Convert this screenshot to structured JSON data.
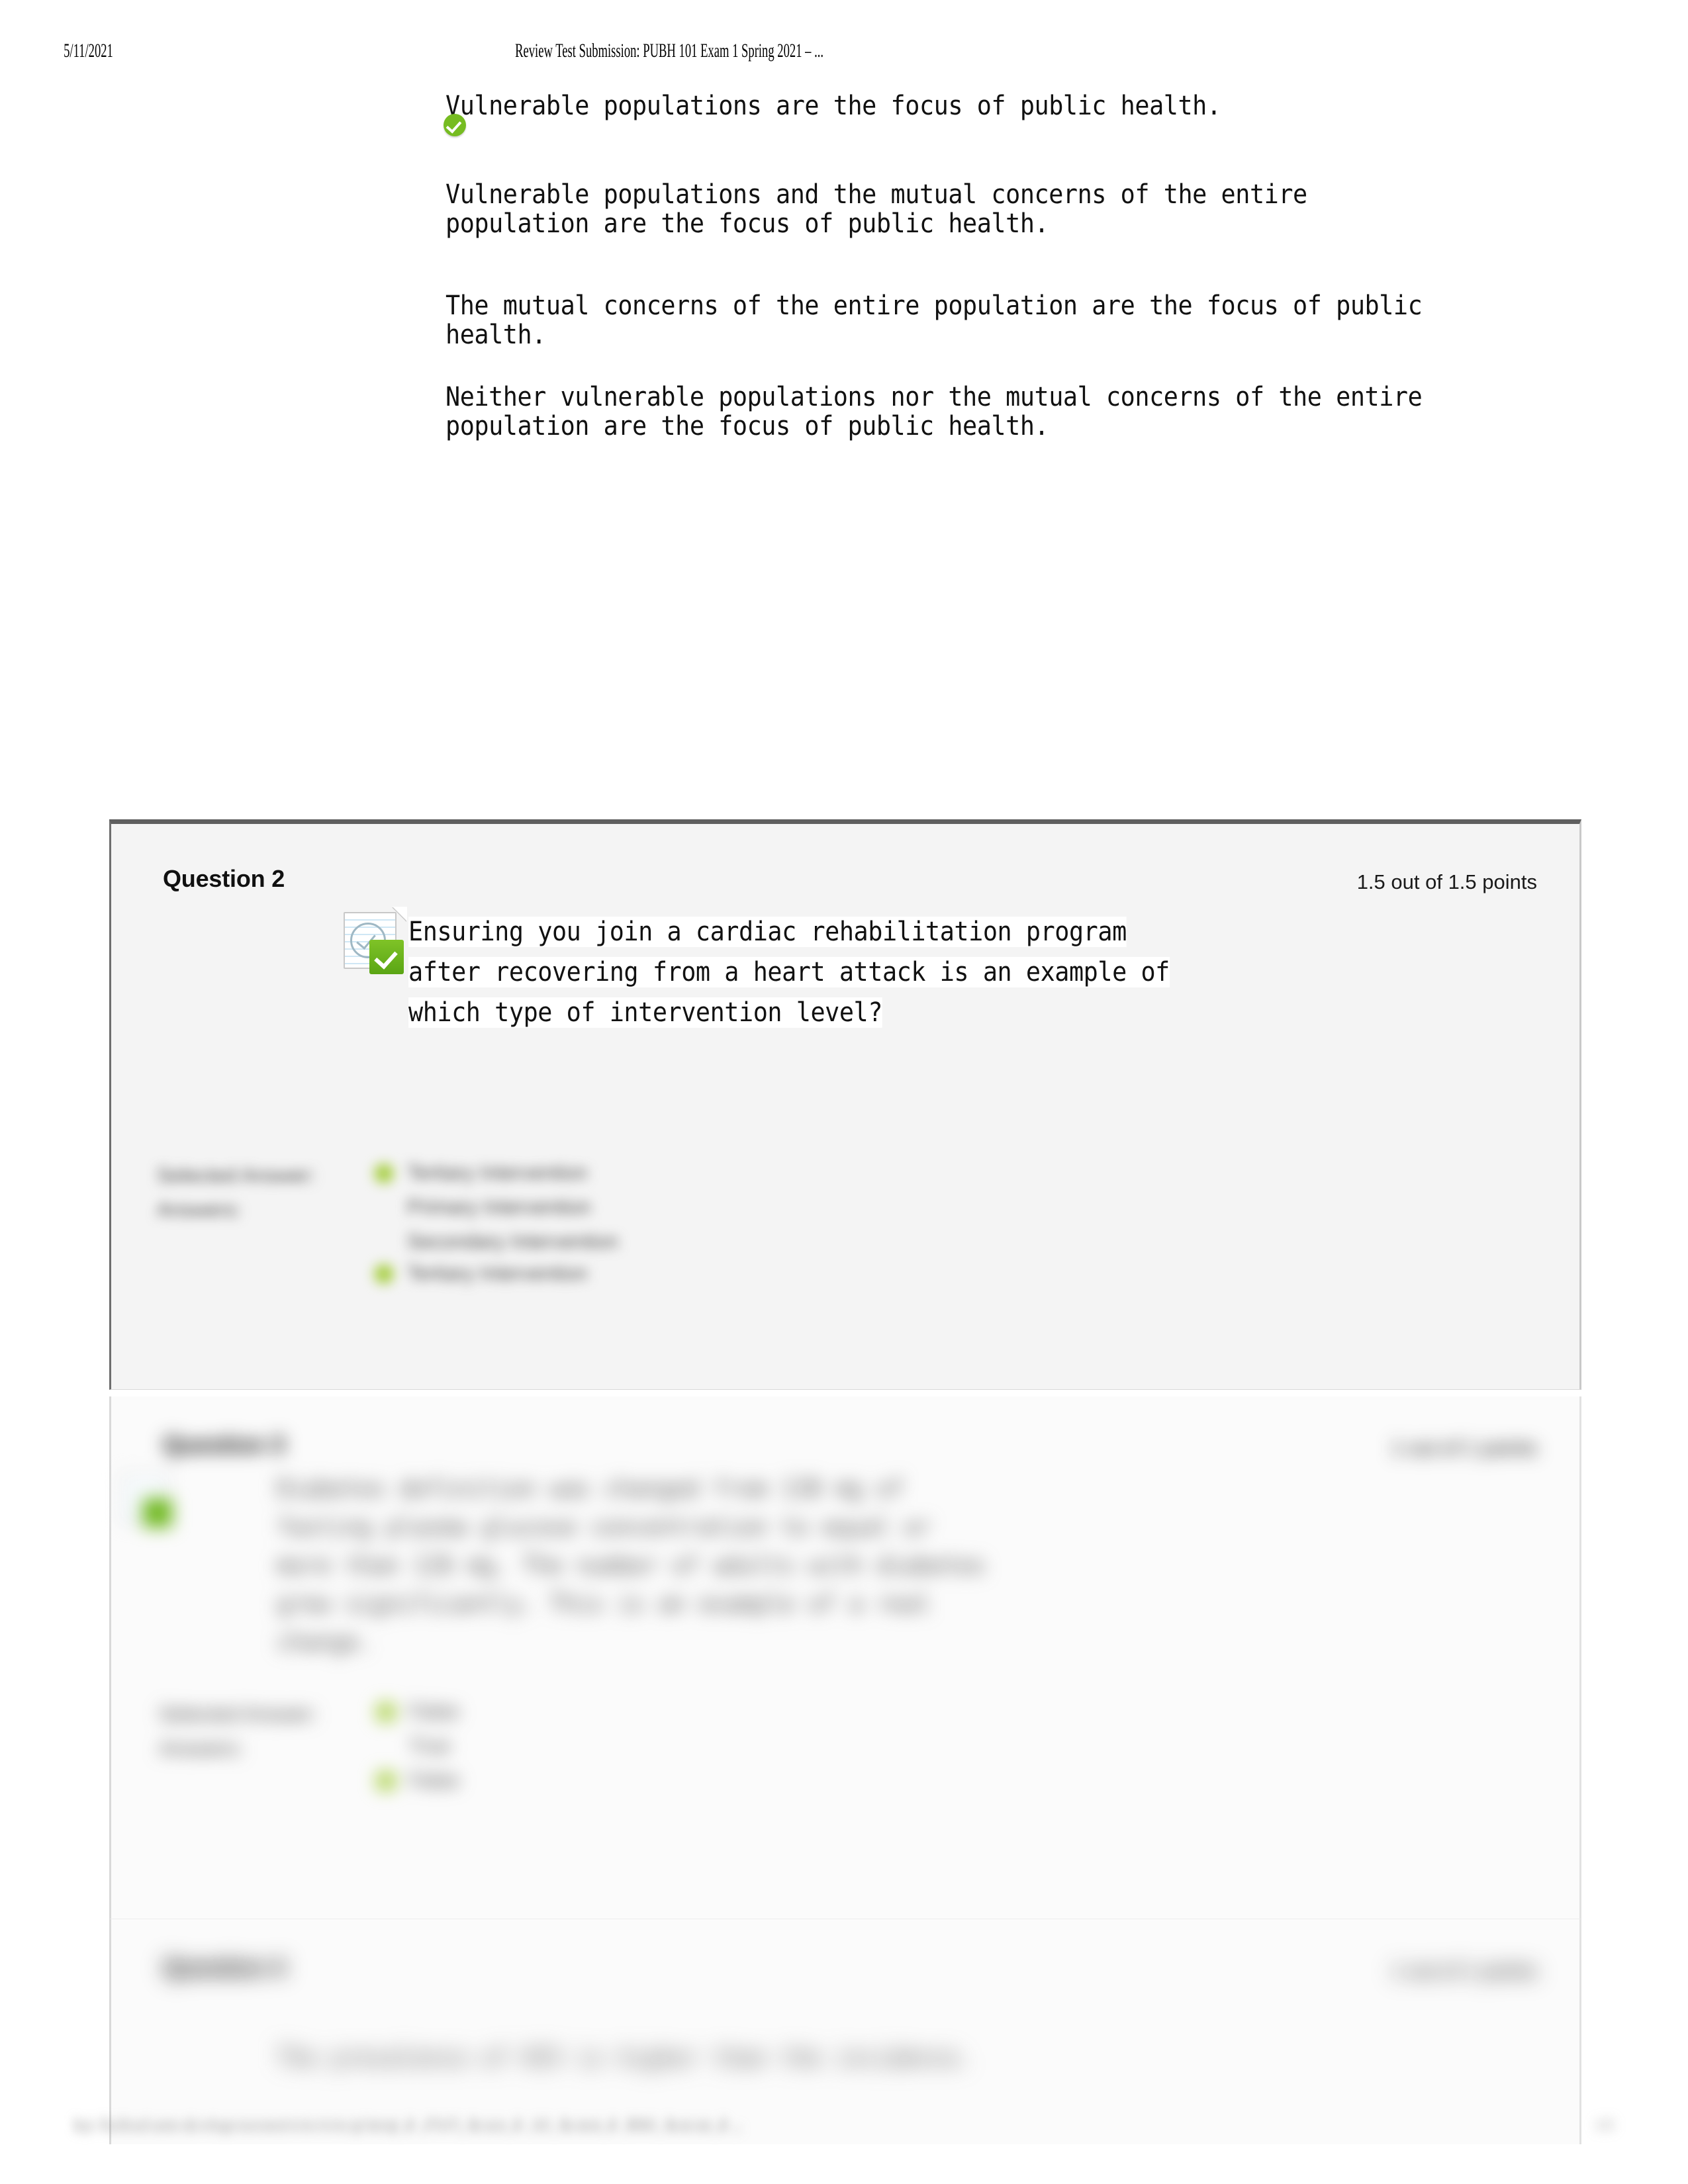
{
  "print_header": {
    "date": "5/11/2021",
    "title": "Review Test Submission: PUBH 101 Exam 1 Spring 2021 – ..."
  },
  "question_1_tail": {
    "options": [
      {
        "text": "Vulnerable populations are the focus of public health.",
        "selected_icon": "none"
      },
      {
        "text": "Vulnerable populations and the mutual concerns of the entire population are the focus of public health.",
        "selected_icon": "green-check-circle-icon"
      },
      {
        "text": "The mutual concerns of the entire population are the focus of public health.",
        "selected_icon": "none"
      },
      {
        "text": "Neither vulnerable populations nor the mutual concerns of the entire population are the focus of public health.",
        "selected_icon": "none"
      }
    ]
  },
  "question_2": {
    "title": "Question 2",
    "points": "1.5 out of 1.5 points",
    "status_icon": "notepad-with-green-check-icon",
    "stem_lines": [
      "Ensuring you join a cardiac rehabilitation program",
      "after recovering from a heart attack is an example of",
      "which type of intervention level?"
    ],
    "selected_answer_label": "Selected Answer:",
    "selected_answer_value": "Tertiary Intervention",
    "answers_label": "Answers:",
    "answer_options": [
      "Primary Intervention",
      "Secondary Intervention",
      "Tertiary Intervention"
    ]
  },
  "question_3": {
    "title": "Question 3",
    "points": "1 out of 1 points",
    "status_icon": "notepad-with-green-check-icon",
    "stem_lines": [
      "Diabetes definition was changed from 130 mg of",
      "fasting plasma glucose concentration to equal or",
      "more than 126 mg. The number of adults with diabetes",
      "grew significantly. This is an example of a real",
      "change."
    ],
    "selected_answer_label": "Selected Answer:",
    "selected_answer_value": "False",
    "answers_label": "Answers:",
    "answer_options": [
      "True",
      "False"
    ]
  },
  "question_4": {
    "title": "Question 4",
    "points": "1 out of 1 points",
    "stem_lines": [
      "The prevalence of HIV is higher than the incidence."
    ]
  },
  "page_footer": {
    "text": "https://blackboard.sumter.edu/webapps/assessment/review/review.jsp?attempt_id=_4791472_1&course_id=_1421_1&content_id=_989661_1&outcome_id=_...",
    "page": "1/5"
  },
  "colors": {
    "green_check": "#76bc21",
    "green_dot": "#a8cf45",
    "shaded_block": "#f4f4f4",
    "block_top_border": "#5f5f5f"
  }
}
